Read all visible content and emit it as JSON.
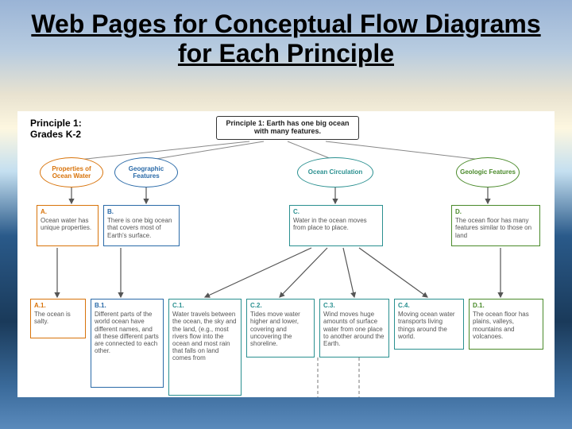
{
  "title": "Web Pages for Conceptual Flow Diagrams for Each Principle",
  "diagram": {
    "principle_label": "Principle 1:\nGrades K-2",
    "root": "Principle 1: Earth has one big ocean with many features.",
    "categories": {
      "properties": "Properties of Ocean Water",
      "geographic": "Geographic Features",
      "circulation": "Ocean Circulation",
      "geologic": "Geologic Features"
    },
    "row2": {
      "A": {
        "label": "A.",
        "text": "Ocean water has unique properties."
      },
      "B": {
        "label": "B.",
        "text": "There is one big ocean that covers most of Earth's surface."
      },
      "C": {
        "label": "C.",
        "text": "Water in the ocean moves from place to place."
      },
      "D": {
        "label": "D.",
        "text": "The ocean floor has many features similar to those on land"
      }
    },
    "row3": {
      "A1": {
        "label": "A.1.",
        "text": "The ocean is salty."
      },
      "B1": {
        "label": "B.1.",
        "text": "Different parts of the world ocean have different names, and all these different parts are connected to each other."
      },
      "C1": {
        "label": "C.1.",
        "text": "Water travels between the ocean, the sky and the land, (e.g., most rivers flow into the ocean and most rain that falls on land comes from"
      },
      "C2": {
        "label": "C.2.",
        "text": "Tides move water higher and lower, covering and uncovering the shoreline."
      },
      "C3": {
        "label": "C.3.",
        "text": "Wind moves huge amounts of surface water from one place to another around the Earth."
      },
      "C4": {
        "label": "C.4.",
        "text": "Moving ocean water transports living things around the world."
      },
      "D1": {
        "label": "D.1.",
        "text": "The ocean floor has plains, valleys, mountains and volcanoes."
      }
    }
  }
}
